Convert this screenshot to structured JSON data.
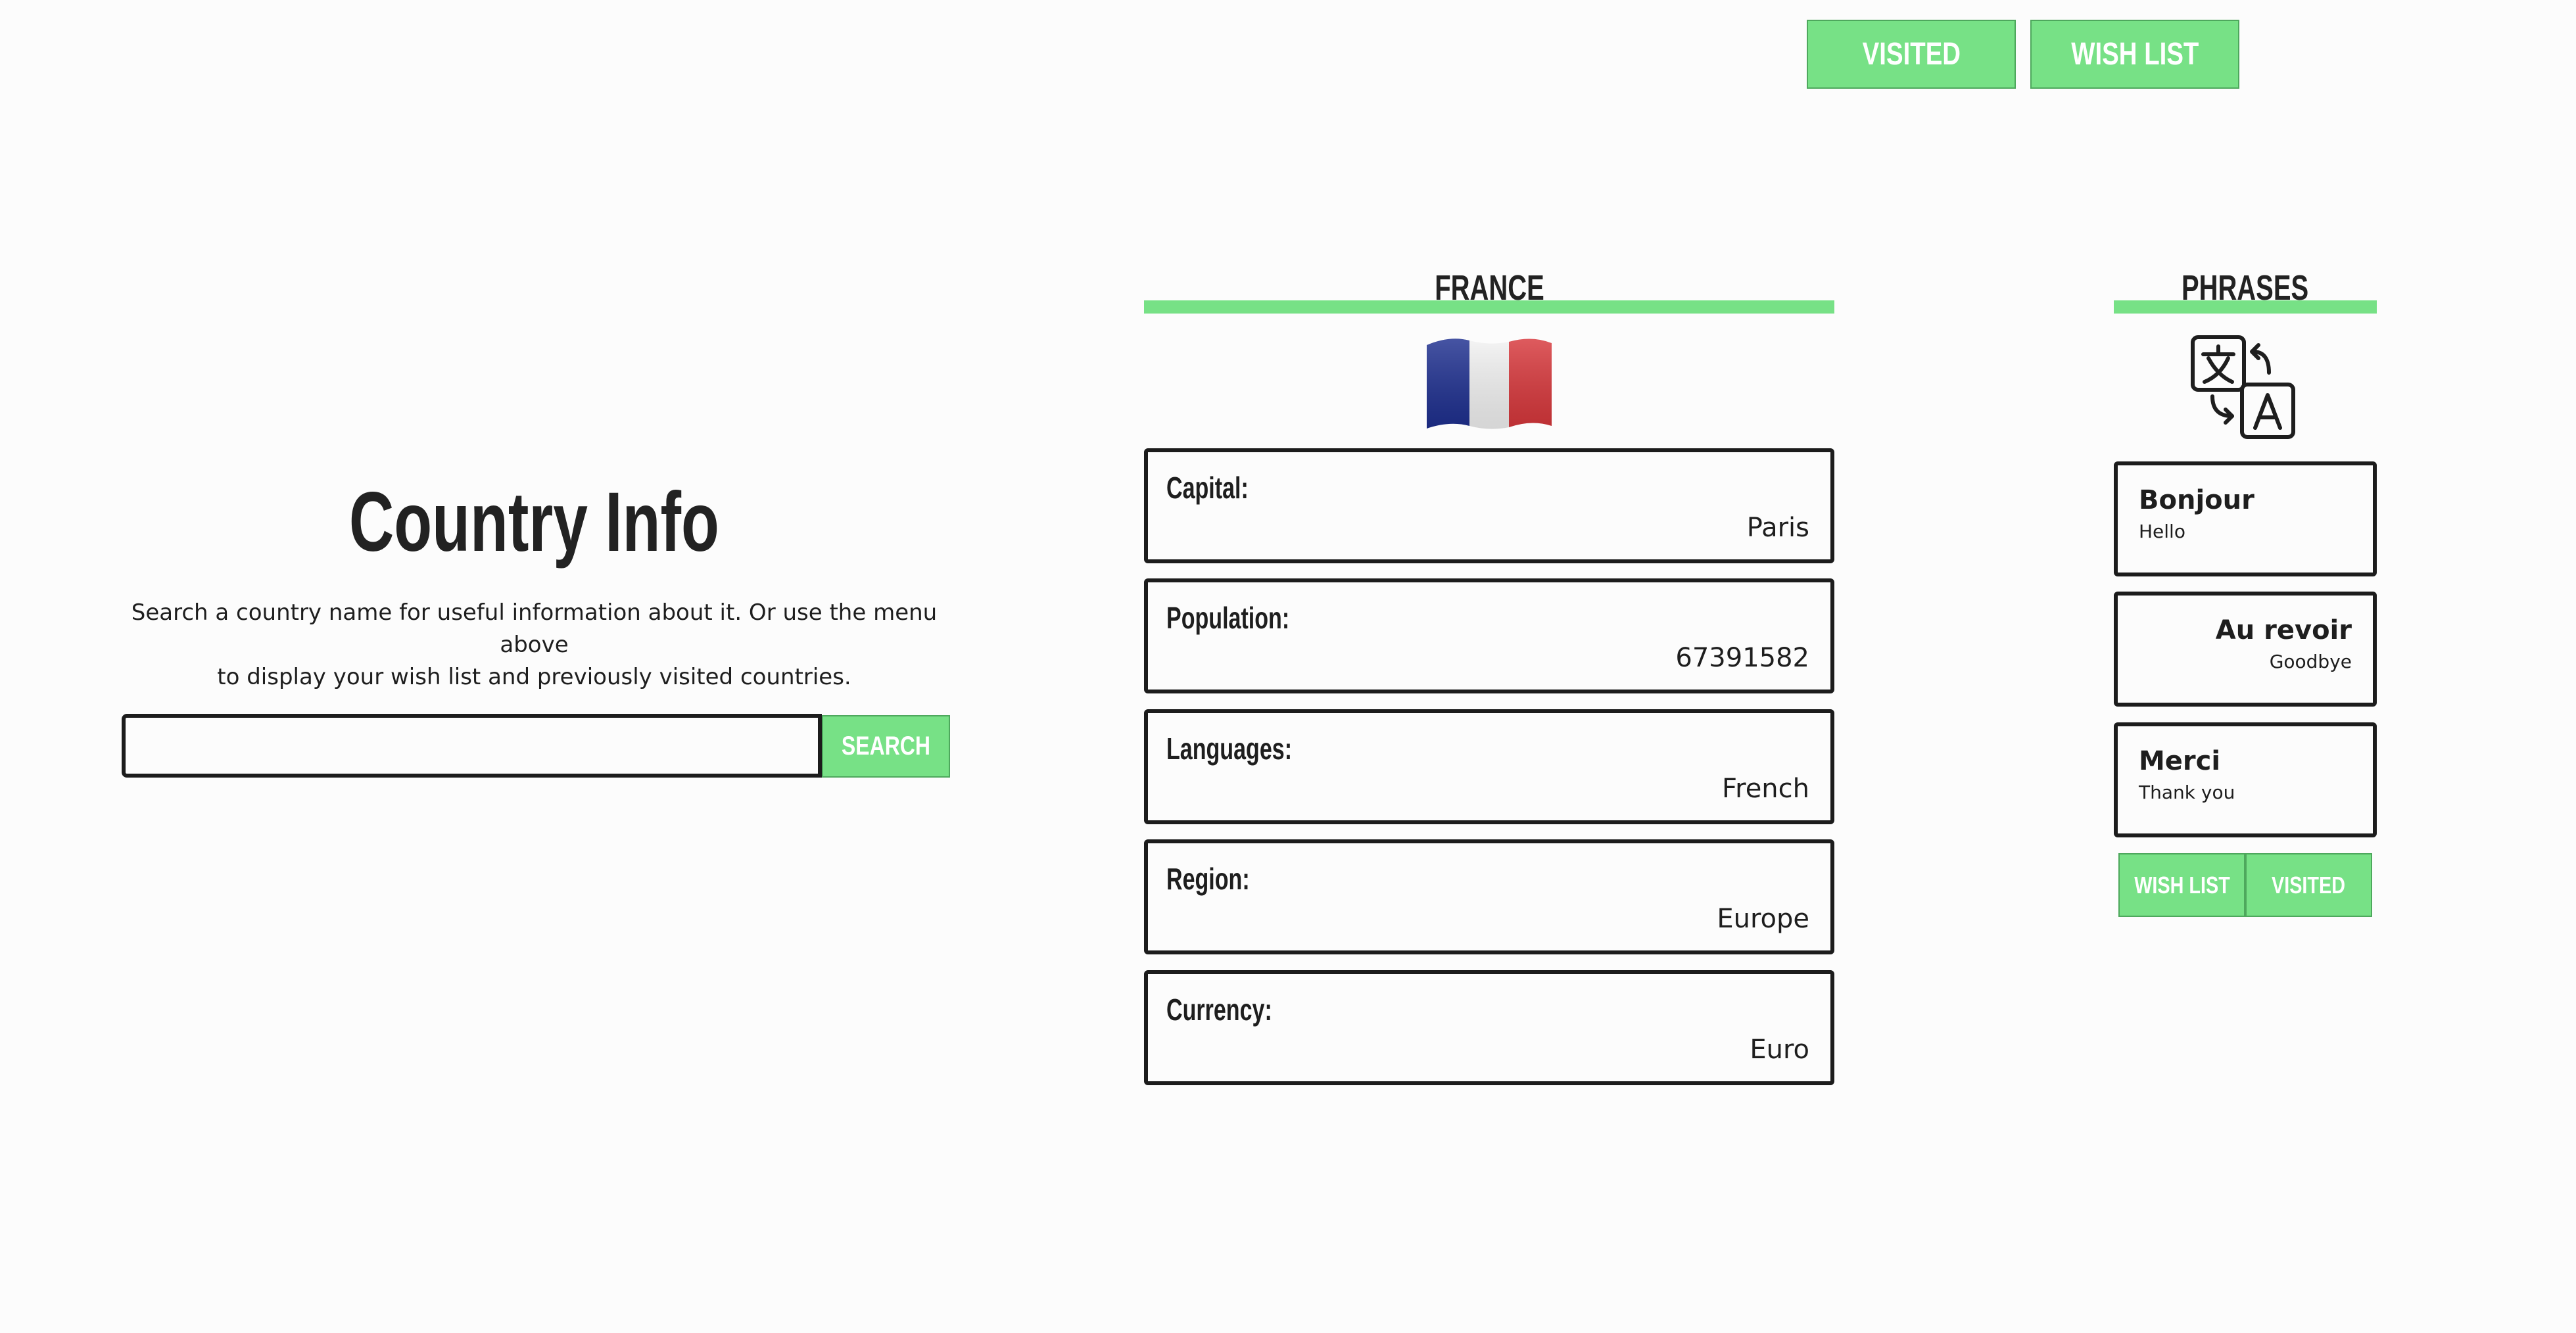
{
  "nav": {
    "visited_label": "VISITED",
    "wishlist_label": "WISH LIST"
  },
  "search_panel": {
    "title": "Country Info",
    "intro_line1": "Search a country name for useful information about it. Or use the menu above",
    "intro_line2": "to display your wish list and previously visited countries.",
    "input_value": "",
    "input_placeholder": "",
    "search_label": "SEARCH"
  },
  "country": {
    "name": "FRANCE",
    "flag": "flag-france-icon",
    "fields": [
      {
        "label": "Capital:",
        "value": "Paris"
      },
      {
        "label": "Population:",
        "value": "67391582"
      },
      {
        "label": "Languages:",
        "value": "French"
      },
      {
        "label": "Region:",
        "value": "Europe"
      },
      {
        "label": "Currency:",
        "value": "Euro"
      }
    ]
  },
  "phrases": {
    "heading": "PHRASES",
    "icon": "translate-icon",
    "items": [
      {
        "phrase": "Bonjour",
        "translation": "Hello"
      },
      {
        "phrase": "Au revoir",
        "translation": "Goodbye"
      },
      {
        "phrase": "Merci",
        "translation": "Thank you"
      }
    ],
    "wishlist_label": "WISH LIST",
    "visited_label": "VISITED"
  },
  "colors": {
    "accent_green": "#77e186",
    "background": "#fcfcfc",
    "border_dark": "#1c1c1c"
  }
}
